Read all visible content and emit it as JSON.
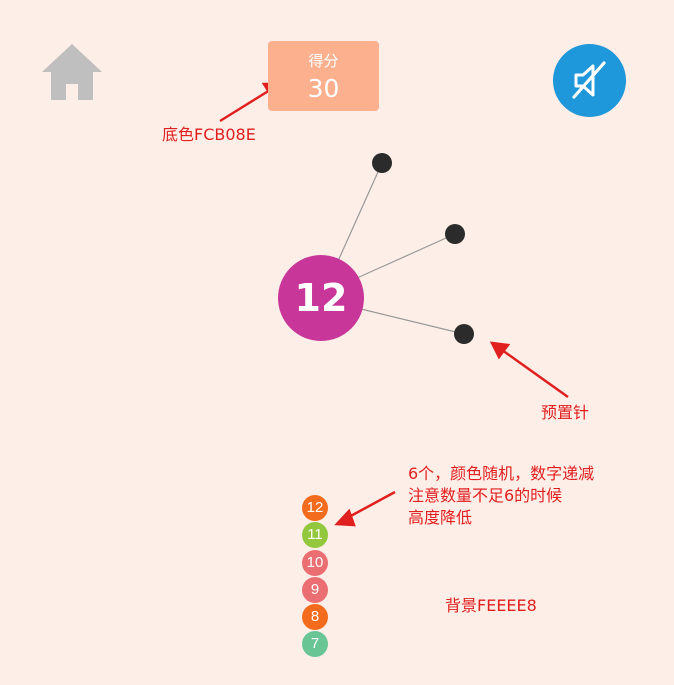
{
  "game": {
    "score_label": "得分",
    "score_value": "30",
    "center_number": "12",
    "center_color": "#C9369A",
    "pin_color": "#2B2B2B",
    "queue": [
      {
        "label": "12",
        "color": "#F36B1C"
      },
      {
        "label": "11",
        "color": "#93C83E"
      },
      {
        "label": "10",
        "color": "#EB6E73"
      },
      {
        "label": "9",
        "color": "#EB6E73"
      },
      {
        "label": "8",
        "color": "#F36B1C"
      },
      {
        "label": "7",
        "color": "#6AC595"
      }
    ]
  },
  "toolbar": {
    "home_icon": "home-icon",
    "sound_icon": "sound-muted-icon",
    "sound_color": "#1E97DB"
  },
  "annotations": {
    "score_bg_note": "底色FCB08E",
    "preset_pins_note": "预置针",
    "queue_note_line1": "6个，颜色随机，数字递减",
    "queue_note_line2": "注意数量不足6的时候",
    "queue_note_line3": "高度降低",
    "background_note": "背景FEEEE8",
    "note_color": "#E01F1F"
  },
  "theme": {
    "background": "#FEEEE8",
    "score_box_bg": "#FCB08E"
  }
}
